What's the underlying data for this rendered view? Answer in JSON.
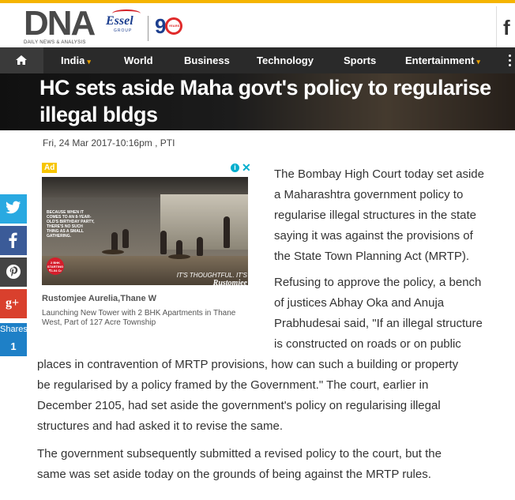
{
  "brand": {
    "logo": "DNA",
    "logo_sub": "DAILY NEWS & ANALYSIS",
    "essel": "Essel",
    "essel_group": "GROUP",
    "ninety": "9",
    "ninety_badge": "YEARS",
    "social_letter": "f"
  },
  "nav": {
    "items": [
      {
        "label": "India",
        "caret": "▾"
      },
      {
        "label": "World"
      },
      {
        "label": "Business"
      },
      {
        "label": "Technology"
      },
      {
        "label": "Sports"
      },
      {
        "label": "Entertainment",
        "caret": "▾"
      }
    ]
  },
  "article": {
    "headline": "HC sets aside Maha govt's policy to regularise illegal bldgs",
    "byline": "Fri, 24 Mar 2017-10:16pm , PTI",
    "p1_lines": [
      "The Bombay High Court today set aside",
      "a Maharashtra government policy to",
      "regularise illegal structures in the state",
      "saying it was against the provisions of",
      "the State Town Planning Act (MRTP)."
    ],
    "p2_narrow_lines": [
      "Refusing to approve the policy, a bench",
      "of justices Abhay Oka and Anuja",
      "Prabhudesai said, \"If an illegal structure",
      "is constructed on roads or on public"
    ],
    "p2_wide_lines": [
      "places in contravention of MRTP provisions, how can such a building or property",
      "be regularised by a policy framed by the Government.\" The court, earlier in",
      "December 2105, had set aside the government's policy on regularising illegal",
      "structures and had asked it to revise the same."
    ],
    "p3_lines": [
      "The government subsequently submitted a revised policy to the court, but the",
      "same was set aside today on the grounds of being against the MRTP rules."
    ]
  },
  "ad": {
    "badge": "Ad",
    "info": "i",
    "close": "✕",
    "copy": "BECAUSE WHEN IT COMES TO AN 8-YEAR-OLD'S BIRTHDAY PARTY, THERE'S NO SUCH THING AS A SMALL GATHERING.",
    "sticker": "2 BHK STARTING ₹1.04 Cr",
    "tagline": "IT'S THOUGHTFUL. IT'S",
    "brand": "Rustomjee",
    "title": "Rustomjee Aurelia,Thane W",
    "description": "Launching New Tower with 2 BHK Apartments in Thane West, Part of 127 Acre Township"
  },
  "share": {
    "google_label": "g+",
    "shares_label": "Shares",
    "shares_count": "1",
    "colors": {
      "twitter": "#29a9e1",
      "facebook": "#3b5b98",
      "pinterest": "#444444",
      "google": "#d9402d",
      "shares": "#1e80c7"
    }
  }
}
